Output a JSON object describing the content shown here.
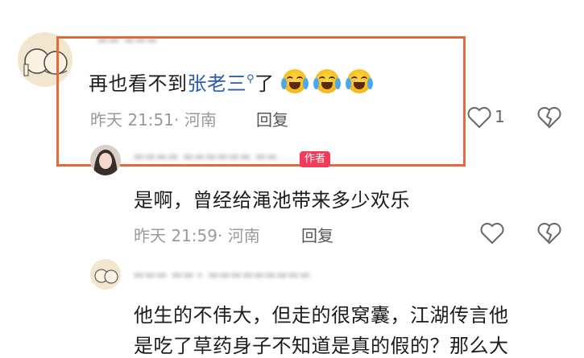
{
  "comment1": {
    "text_prefix": "再也看不到",
    "link_text": "张老三",
    "text_suffix": "了",
    "time_location": "昨天 21:51· 河南",
    "reply_label": "回复",
    "like_count": "1"
  },
  "comment2": {
    "author_tag": "作者",
    "text": "是啊，曾经给渑池带来多少欢乐",
    "time_location": "昨天 21:59· 河南",
    "reply_label": "回复"
  },
  "comment3": {
    "text_line1": "他生的不伟大，但走的很窝囊，江湖传言他",
    "text_line2": "是吃了草药身子不知道是真的假的？那么大"
  },
  "colors": {
    "highlight": "#e46a3e",
    "link": "#2b5ea8",
    "author_tag": "#f23b5a"
  }
}
